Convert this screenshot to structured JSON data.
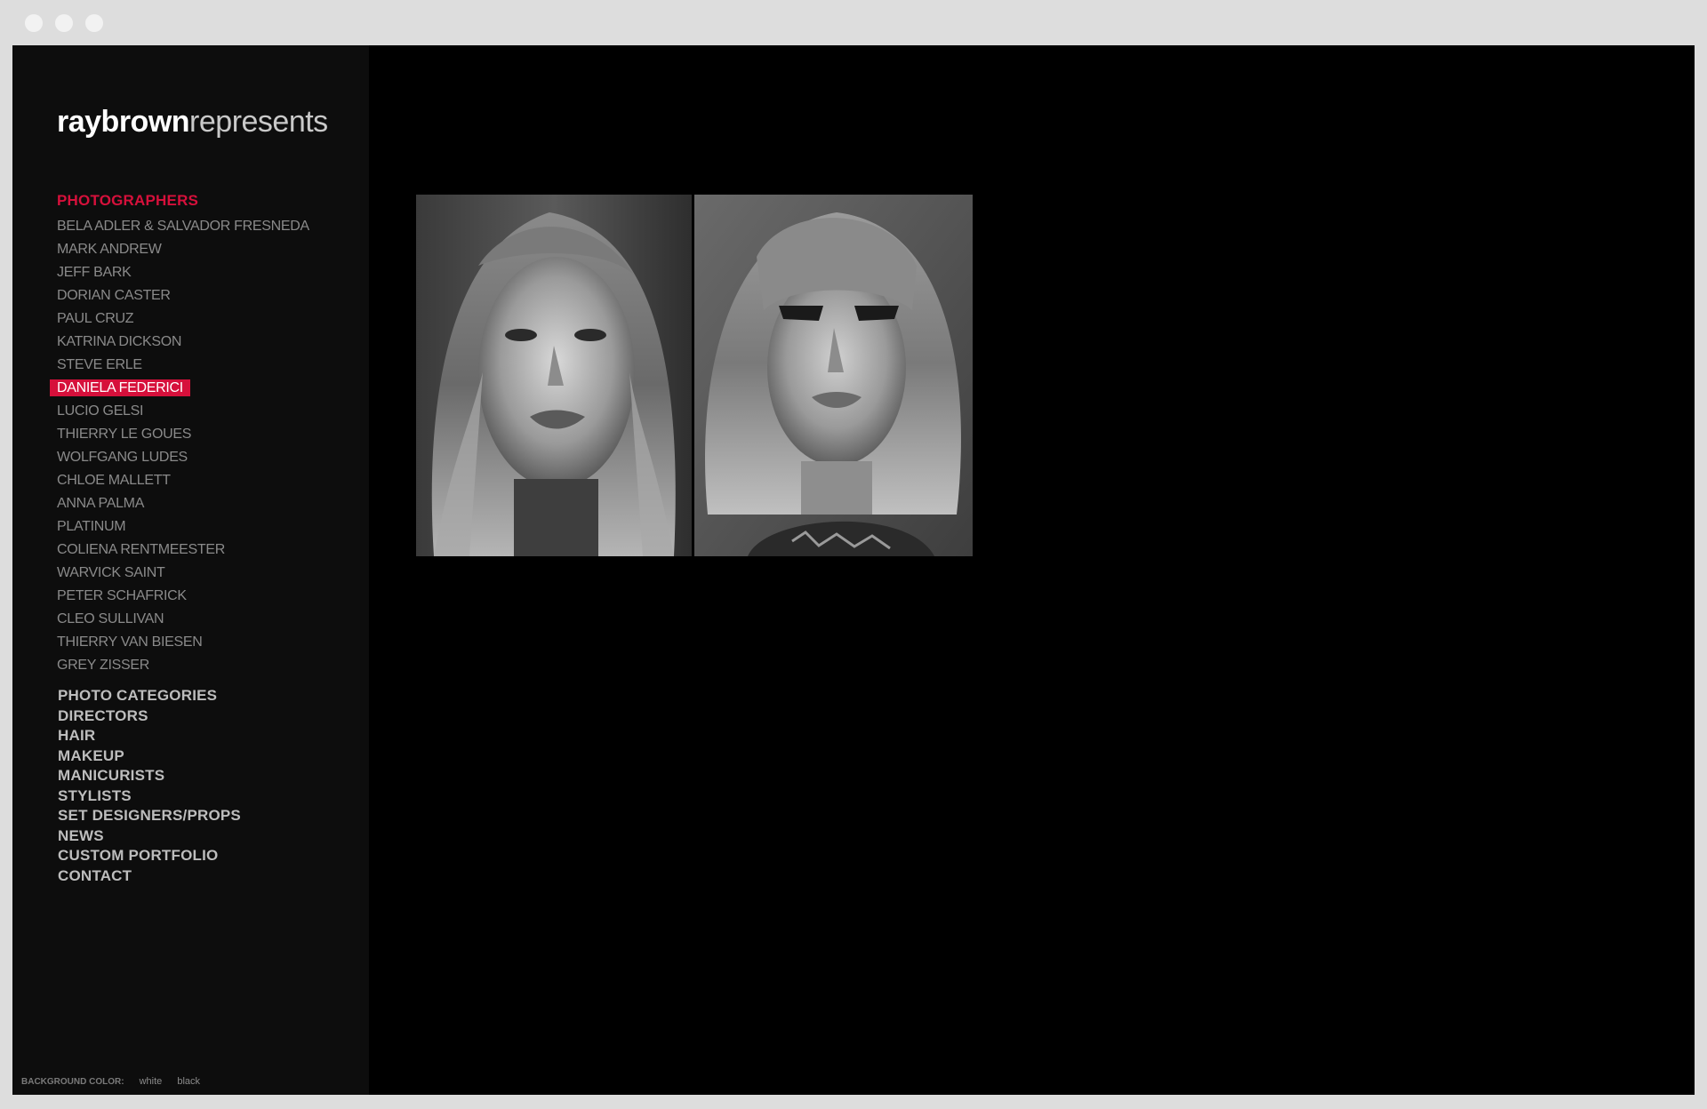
{
  "logo": {
    "bold": "raybrown",
    "light": "represents"
  },
  "sidebar": {
    "section_title": "PHOTOGRAPHERS",
    "photographers": [
      "BELA ADLER & SALVADOR FRESNEDA",
      "MARK ANDREW",
      "JEFF BARK",
      "DORIAN CASTER",
      "PAUL CRUZ",
      "KATRINA DICKSON",
      "STEVE ERLE",
      "DANIELA FEDERICI",
      "LUCIO GELSI",
      "THIERRY LE GOUES",
      "WOLFGANG LUDES",
      "CHLOE MALLETT",
      "ANNA PALMA",
      "PLATINUM",
      "COLIENA RENTMEESTER",
      "WARVICK SAINT",
      "PETER SCHAFRICK",
      "CLEO SULLIVAN",
      "THIERRY VAN BIESEN",
      "GREY ZISSER"
    ],
    "active_photographer": "DANIELA FEDERICI",
    "nav": [
      "PHOTO CATEGORIES",
      "DIRECTORS",
      "HAIR",
      "MAKEUP",
      "MANICURISTS",
      "STYLISTS",
      "SET DESIGNERS/PROPS",
      "NEWS",
      "CUSTOM PORTFOLIO",
      "CONTACT"
    ]
  },
  "footer": {
    "label": "BACKGROUND COLOR:",
    "options": [
      "white",
      "black"
    ]
  },
  "colors": {
    "accent": "#d6103b",
    "sidebar_bg": "#0d0d0d",
    "main_bg": "#000000",
    "photographer_text": "#8a8a8a",
    "nav_text": "#bdbdbd"
  }
}
